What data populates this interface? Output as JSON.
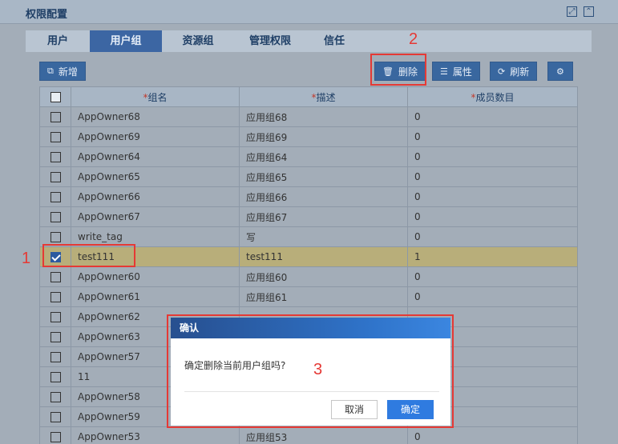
{
  "panel": {
    "title": "权限配置"
  },
  "tabs": [
    {
      "label": "用户",
      "active": false
    },
    {
      "label": "用户组",
      "active": true
    },
    {
      "label": "资源组",
      "active": false
    },
    {
      "label": "管理权限",
      "active": false
    },
    {
      "label": "信任",
      "active": false
    }
  ],
  "toolbar": {
    "add_label": "新增",
    "delete_label": "删除",
    "props_label": "属性",
    "refresh_label": "刷新"
  },
  "table": {
    "columns": [
      "组名",
      "描述",
      "成员数目"
    ],
    "required_mark": "*",
    "rows": [
      {
        "name": "AppOwner68",
        "desc": "应用组68",
        "count": "0",
        "checked": false
      },
      {
        "name": "AppOwner69",
        "desc": "应用组69",
        "count": "0",
        "checked": false
      },
      {
        "name": "AppOwner64",
        "desc": "应用组64",
        "count": "0",
        "checked": false
      },
      {
        "name": "AppOwner65",
        "desc": "应用组65",
        "count": "0",
        "checked": false
      },
      {
        "name": "AppOwner66",
        "desc": "应用组66",
        "count": "0",
        "checked": false
      },
      {
        "name": "AppOwner67",
        "desc": "应用组67",
        "count": "0",
        "checked": false
      },
      {
        "name": "write_tag",
        "desc": "写",
        "count": "0",
        "checked": false
      },
      {
        "name": "test111",
        "desc": "test111",
        "count": "1",
        "checked": true
      },
      {
        "name": "AppOwner60",
        "desc": "应用组60",
        "count": "0",
        "checked": false
      },
      {
        "name": "AppOwner61",
        "desc": "应用组61",
        "count": "0",
        "checked": false
      },
      {
        "name": "AppOwner62",
        "desc": "",
        "count": "",
        "checked": false
      },
      {
        "name": "AppOwner63",
        "desc": "",
        "count": "",
        "checked": false
      },
      {
        "name": "AppOwner57",
        "desc": "",
        "count": "",
        "checked": false
      },
      {
        "name": "11",
        "desc": "",
        "count": "",
        "checked": false
      },
      {
        "name": "AppOwner58",
        "desc": "",
        "count": "",
        "checked": false
      },
      {
        "name": "AppOwner59",
        "desc": "",
        "count": "",
        "checked": false
      },
      {
        "name": "AppOwner53",
        "desc": "应用组53",
        "count": "0",
        "checked": false
      }
    ]
  },
  "annotations": {
    "n1": "1",
    "n2": "2",
    "n3": "3"
  },
  "dialog": {
    "title": "确认",
    "message": "确定删除当前用户组吗?",
    "cancel_label": "取消",
    "ok_label": "确定"
  }
}
